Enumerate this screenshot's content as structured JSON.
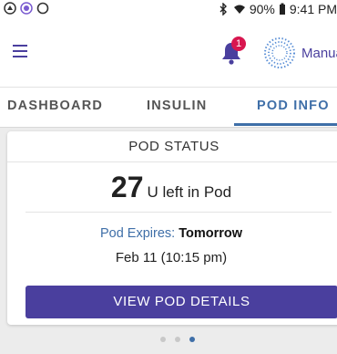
{
  "status_bar": {
    "battery": "90%",
    "time": "9:41 PM",
    "icons": [
      "notification-icon",
      "record-icon",
      "ring-icon",
      "bluetooth-icon",
      "wifi-icon",
      "battery-icon"
    ]
  },
  "app_bar": {
    "notification_count": "1",
    "mode_label": "Manual",
    "icons": [
      "hamburger-menu-icon",
      "bell-icon",
      "pod-dotted-circle-icon"
    ]
  },
  "tabs": [
    {
      "label": "DASHBOARD",
      "active": false
    },
    {
      "label": "INSULIN",
      "active": false
    },
    {
      "label": "POD INFO",
      "active": true
    }
  ],
  "pod_status": {
    "title": "POD STATUS",
    "units_value": "27",
    "units_text": "U left in Pod",
    "expires_label": "Pod Expires:",
    "expires_value": "Tomorrow",
    "expires_date": "Feb 11 (10:15 pm)",
    "button_label": "VIEW POD DETAILS"
  },
  "pager": {
    "count": 3,
    "active_index": 2
  },
  "colors": {
    "primary": "#4a3f9e",
    "accent_blue": "#3f6fa8",
    "badge_red": "#d8164f",
    "background": "#ececec"
  }
}
